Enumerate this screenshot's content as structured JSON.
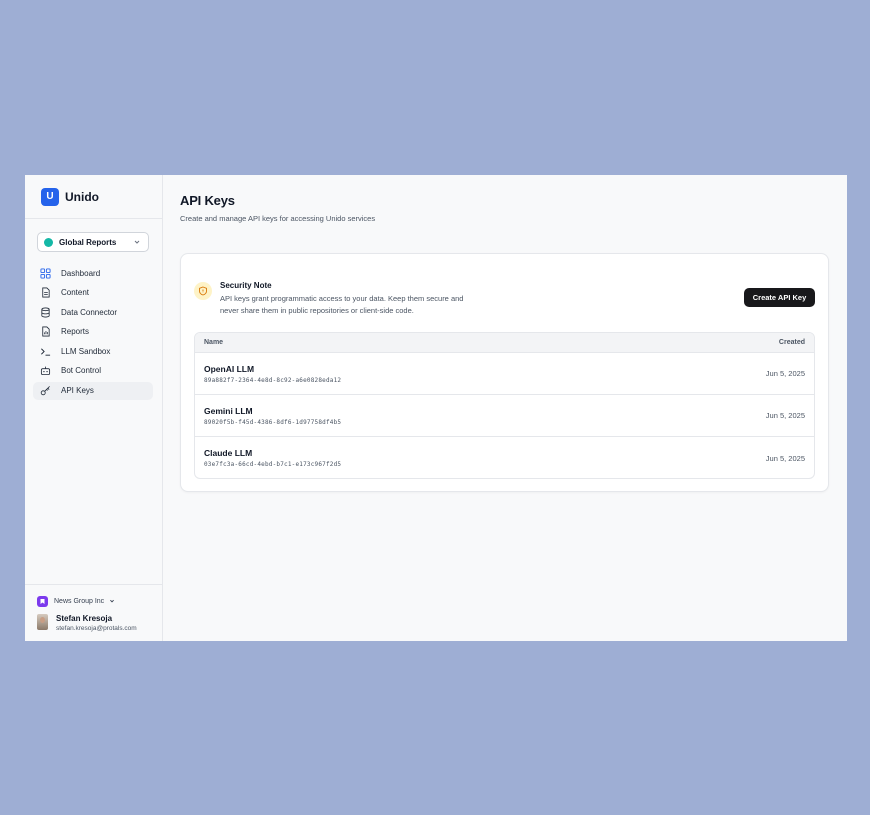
{
  "brand": {
    "logo_letter": "U",
    "name": "Unido",
    "accent": "#2563eb"
  },
  "workspace": {
    "label": "Global Reports",
    "dot_color": "#14b8a6"
  },
  "sidebar": {
    "items": [
      {
        "label": "Dashboard",
        "icon": "dashboard-icon",
        "active": false
      },
      {
        "label": "Content",
        "icon": "document-icon",
        "active": false
      },
      {
        "label": "Data Connector",
        "icon": "database-icon",
        "active": false
      },
      {
        "label": "Reports",
        "icon": "report-icon",
        "active": false
      },
      {
        "label": "LLM Sandbox",
        "icon": "terminal-icon",
        "active": false
      },
      {
        "label": "Bot Control",
        "icon": "bot-icon",
        "active": false
      },
      {
        "label": "API Keys",
        "icon": "key-icon",
        "active": true
      }
    ]
  },
  "footer": {
    "org": "News Group Inc",
    "user": {
      "name": "Stefan Kresoja",
      "email": "stefan.kresoja@protals.com"
    }
  },
  "main": {
    "title": "API Keys",
    "subtitle": "Create and manage API keys for accessing Unido services",
    "note": {
      "title": "Security Note",
      "body": "API keys grant programmatic access to your data. Keep them secure and never share them in public repositories or client-side code."
    },
    "create_button": "Create API Key",
    "table": {
      "headers": {
        "name": "Name",
        "created": "Created"
      },
      "rows": [
        {
          "name": "OpenAI LLM",
          "id": "89a882f7-2364-4e8d-8c92-a6e0828eda12",
          "created": "Jun 5, 2025"
        },
        {
          "name": "Gemini LLM",
          "id": "89020f5b-f45d-4386-8df6-1d97758df4b5",
          "created": "Jun 5, 2025"
        },
        {
          "name": "Claude LLM",
          "id": "03e7fc3a-66cd-4ebd-b7c1-e173c967f2d5",
          "created": "Jun 5, 2025"
        }
      ]
    }
  }
}
